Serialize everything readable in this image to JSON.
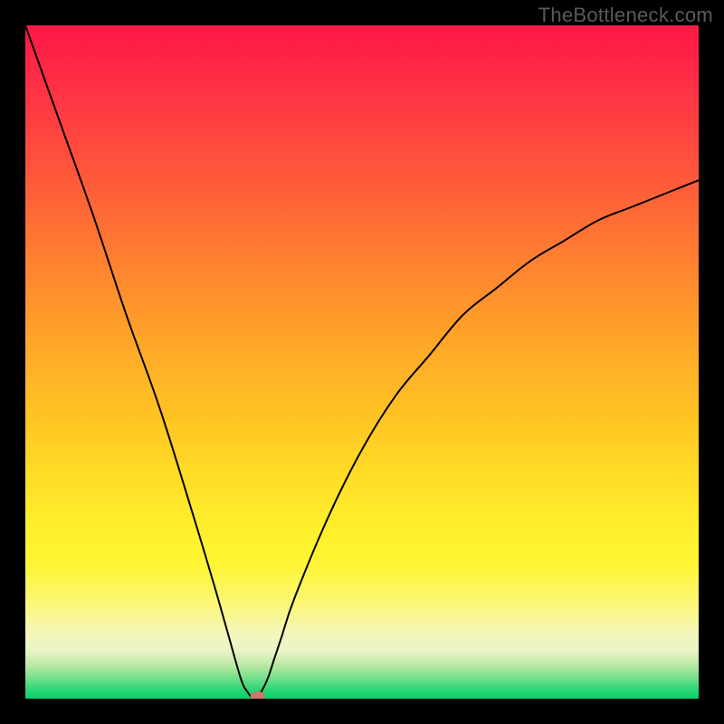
{
  "watermark": "TheBottleneck.com",
  "chart_data": {
    "type": "line",
    "title": "",
    "xlabel": "",
    "ylabel": "",
    "xlim": [
      0,
      100
    ],
    "ylim": [
      0,
      100
    ],
    "grid": false,
    "legend": false,
    "series": [
      {
        "name": "bottleneck-curve",
        "x": [
          0,
          5,
          10,
          15,
          20,
          25,
          28,
          30,
          32,
          33,
          34,
          35,
          36,
          37,
          38,
          40,
          45,
          50,
          55,
          60,
          65,
          70,
          75,
          80,
          85,
          90,
          95,
          100
        ],
        "y": [
          100,
          86,
          72,
          57,
          43,
          27,
          17,
          10,
          3,
          1,
          0,
          1,
          3,
          6,
          9,
          15,
          27,
          37,
          45,
          51,
          57,
          61,
          65,
          68,
          71,
          73,
          75,
          77
        ]
      }
    ],
    "marker": {
      "x": 34.5,
      "y": 0.3,
      "color": "#c77b6a"
    },
    "gradient_stops": [
      {
        "pct": 0,
        "color": "#ff1746"
      },
      {
        "pct": 50,
        "color": "#ffb826"
      },
      {
        "pct": 80,
        "color": "#fff534"
      },
      {
        "pct": 100,
        "color": "#0fcd6d"
      }
    ]
  }
}
